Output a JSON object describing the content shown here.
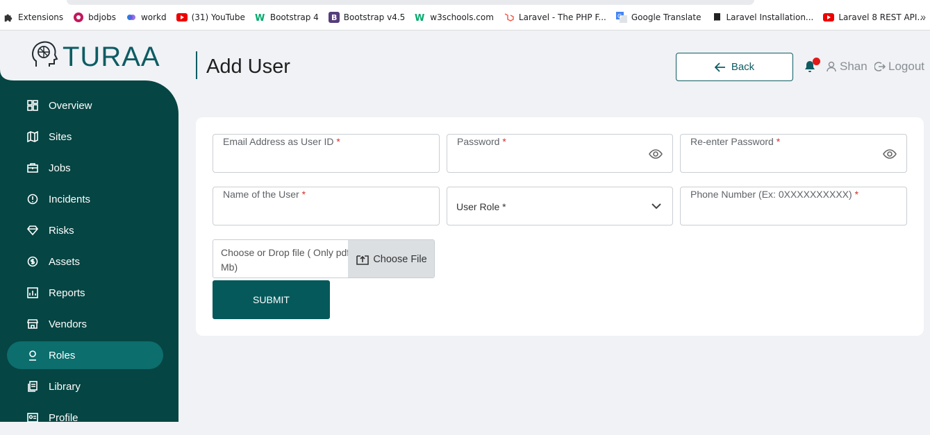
{
  "bookmarks": [
    {
      "label": "Extensions",
      "icon": "puzzle-icon"
    },
    {
      "label": "bdjobs",
      "icon": "bdjobs-icon"
    },
    {
      "label": "workd",
      "icon": "workd-icon"
    },
    {
      "label": "(31) YouTube",
      "icon": "youtube-icon"
    },
    {
      "label": "Bootstrap 4",
      "icon": "w3-icon"
    },
    {
      "label": "Bootstrap v4.5",
      "icon": "bootstrap-icon"
    },
    {
      "label": "w3schools.com",
      "icon": "w3-icon"
    },
    {
      "label": "Laravel - The PHP F...",
      "icon": "laravel-icon"
    },
    {
      "label": "Google Translate",
      "icon": "translate-icon"
    },
    {
      "label": "Laravel Installation...",
      "icon": "book-icon"
    },
    {
      "label": "Laravel 8 REST API...",
      "icon": "youtube-icon"
    }
  ],
  "bookmarks_more": "»",
  "brand": {
    "name": "TURAA",
    "color": "#0d5c63",
    "sidebar_color": "#054543",
    "active_color": "#0c6e6d"
  },
  "sidebar": {
    "items": [
      {
        "label": "Overview",
        "icon": "dashboard-icon",
        "active": false
      },
      {
        "label": "Sites",
        "icon": "map-icon",
        "active": false
      },
      {
        "label": "Jobs",
        "icon": "briefcase-icon",
        "active": false
      },
      {
        "label": "Incidents",
        "icon": "alert-circle-icon",
        "active": false
      },
      {
        "label": "Risks",
        "icon": "diamond-icon",
        "active": false
      },
      {
        "label": "Assets",
        "icon": "dollar-circle-icon",
        "active": false
      },
      {
        "label": "Reports",
        "icon": "report-icon",
        "active": false
      },
      {
        "label": "Vendors",
        "icon": "store-icon",
        "active": false
      },
      {
        "label": "Roles",
        "icon": "person-icon",
        "active": true
      },
      {
        "label": "Library",
        "icon": "library-icon",
        "active": false
      },
      {
        "label": "Profile",
        "icon": "profile-icon",
        "active": false
      }
    ]
  },
  "header": {
    "title": "Add User",
    "back_label": "Back",
    "user_name": "Shan",
    "logout_label": "Logout"
  },
  "form": {
    "email_label": "Email Address as User ID",
    "password_label": "Password",
    "reenter_label": "Re-enter Password",
    "name_label": "Name of the User",
    "role_value": "User Role *",
    "phone_label": "Phone Number (Ex: 0XXXXXXXXXX)",
    "required_mark": "*",
    "file_text_line1": "Choose or Drop file ( Only pdf",
    "file_text_line2": "Mb)",
    "choose_file_label": "Choose File",
    "submit_label": "SUBMIT"
  }
}
